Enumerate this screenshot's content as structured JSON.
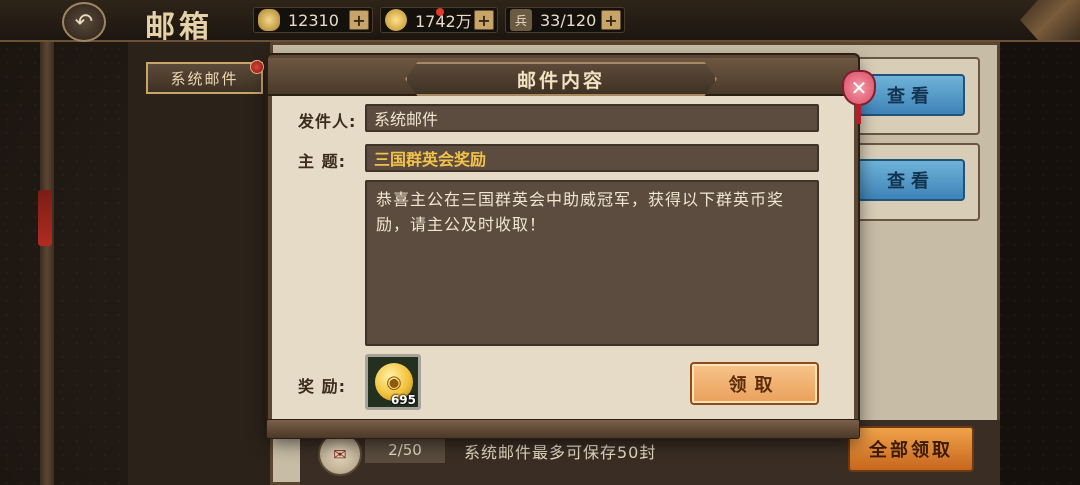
{
  "topbar": {
    "title": "邮箱",
    "resources": [
      {
        "icon": "ingot-icon",
        "value": "12310"
      },
      {
        "icon": "coin-icon",
        "value": "1742万"
      },
      {
        "icon": "troop-icon",
        "value": "33/120"
      }
    ]
  },
  "sidebar": {
    "tab_label": "系统邮件"
  },
  "mail_list": {
    "view_buttons": [
      "查看",
      "查看"
    ]
  },
  "footer": {
    "count": "2/50",
    "note": "系统邮件最多可保存50封",
    "claim_all_label": "全部领取"
  },
  "modal": {
    "title": "邮件内容",
    "sender_label": "发件人:",
    "sender": "系统邮件",
    "subject_label": "主 题:",
    "subject": "三国群英会奖励",
    "body": "恭喜主公在三国群英会中助威冠军，获得以下群英币奖励，请主公及时收取！",
    "reward_label": "奖 励:",
    "reward_qty": "695",
    "claim_label": "领取"
  },
  "colors": {
    "subject_text": "#f3c24a",
    "claim_button": "#eaa05b",
    "close_button": "#d94b63"
  }
}
